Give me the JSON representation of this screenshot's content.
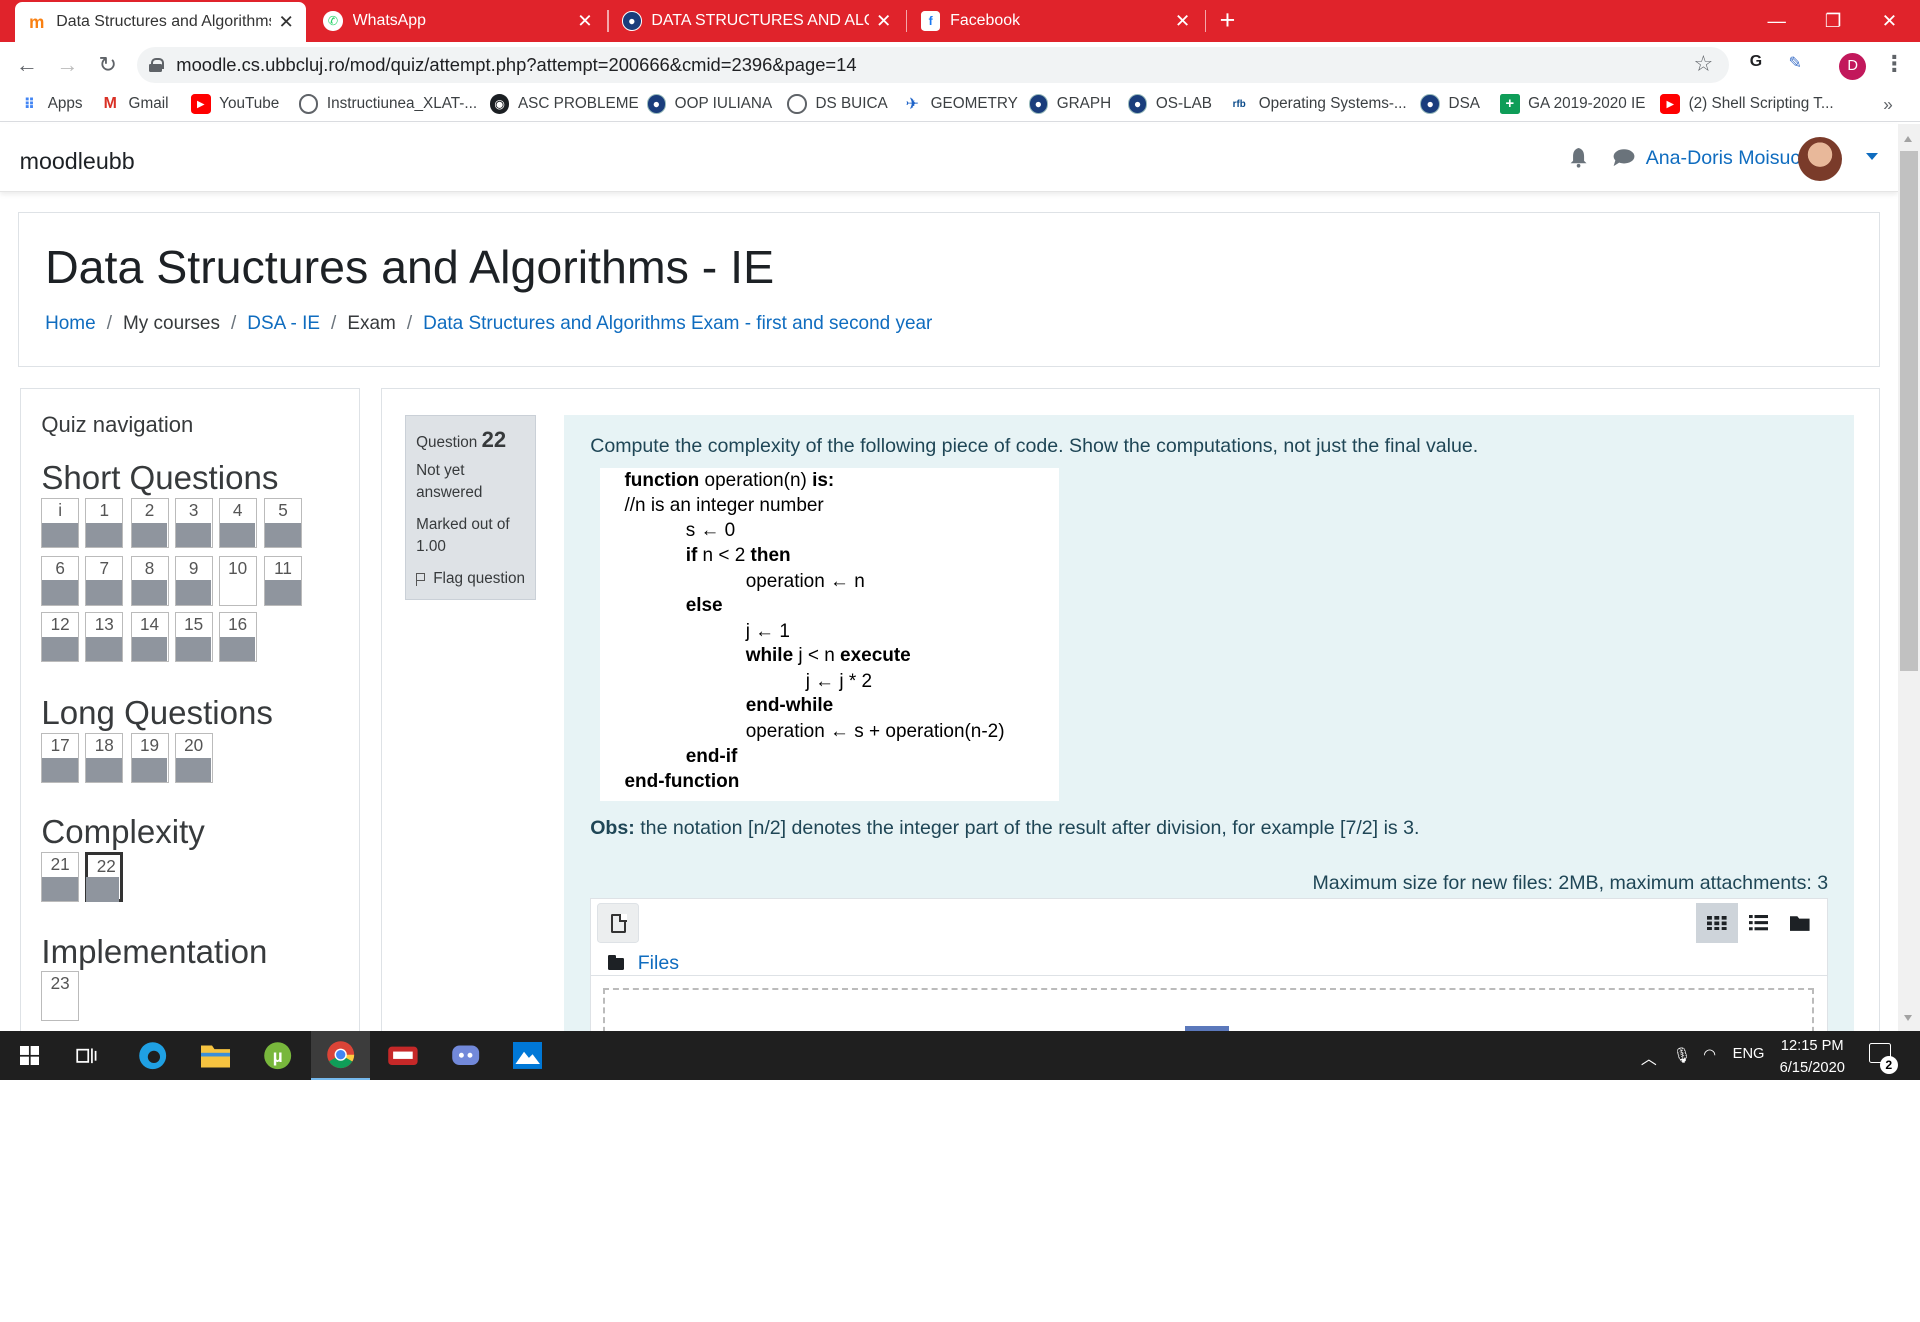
{
  "browser": {
    "tabs": [
      {
        "title": "Data Structures and Algorithms E",
        "favicon": "moodle-icon"
      },
      {
        "title": "WhatsApp",
        "favicon": "whatsapp-icon"
      },
      {
        "title": "DATA STRUCTURES AND ALGORI",
        "favicon": "globe-icon"
      },
      {
        "title": "Facebook",
        "favicon": "facebook-icon"
      }
    ],
    "url": "moodle.cs.ubbcluj.ro/mod/quiz/attempt.php?attempt=200666&cmid=2396&page=14",
    "profile_initial": "D",
    "bookmarks": [
      {
        "label": "Apps"
      },
      {
        "label": "Gmail"
      },
      {
        "label": "YouTube"
      },
      {
        "label": "Instructiunea_XLAT-..."
      },
      {
        "label": "ASC PROBLEME"
      },
      {
        "label": "OOP IULIANA"
      },
      {
        "label": "DS BUICA"
      },
      {
        "label": "GEOMETRY"
      },
      {
        "label": "GRAPH"
      },
      {
        "label": "OS-LAB"
      },
      {
        "label": "Operating Systems-..."
      },
      {
        "label": "DSA"
      },
      {
        "label": "GA 2019-2020 IE"
      },
      {
        "label": "(2) Shell Scripting T..."
      }
    ],
    "bookmarks_more": "»"
  },
  "header": {
    "brand": "moodleubb",
    "user_name": "Ana-Doris Moisuc"
  },
  "page": {
    "title": "Data Structures and Algorithms - IE",
    "breadcrumbs": [
      "Home",
      "My courses",
      "DSA - IE",
      "Exam",
      "Data Structures and Algorithms Exam - first and second year"
    ]
  },
  "quiz_nav": {
    "title": "Quiz navigation",
    "sections": [
      {
        "name": "Short Questions",
        "buttons": [
          "i",
          "1",
          "2",
          "3",
          "4",
          "5",
          "6",
          "7",
          "8",
          "9",
          "10",
          "11",
          "12",
          "13",
          "14",
          "15",
          "16"
        ]
      },
      {
        "name": "Long Questions",
        "buttons": [
          "17",
          "18",
          "19",
          "20"
        ]
      },
      {
        "name": "Complexity",
        "buttons": [
          "21",
          "22"
        ]
      },
      {
        "name": "Implementation",
        "buttons": [
          "23"
        ]
      }
    ],
    "current": "22",
    "unanswered": [
      "10",
      "23"
    ]
  },
  "question": {
    "label": "Question",
    "number": "22",
    "state": "Not yet answered",
    "grade": "Marked out of 1.00",
    "flag": "Flag question",
    "text": "Compute the complexity of the following piece of code. Show the computations, not just the final value.",
    "code": {
      "l1_kw": "function",
      "l1_mid": " operation(n) ",
      "l1_kw2": "is:",
      "l2": "//n is an integer number",
      "l3": "s ← 0",
      "l4_kw": "if",
      "l4_mid": " n < 2 ",
      "l4_kw2": "then",
      "l5": "operation ← n",
      "l6_kw": "else",
      "l7": "j ← 1",
      "l8_kw": "while",
      "l8_mid": " j < n ",
      "l8_kw2": "execute",
      "l9": "j ← j * 2",
      "l10_kw": "end-while",
      "l11": "operation ← s + operation(n-2)",
      "l12_kw": "end-if",
      "l13_kw": "end-function"
    },
    "obs_label": "Obs:",
    "obs_text": " the notation [n/2] denotes the integer part of the result after division, for example [7/2] is 3.",
    "max_files": "Maximum size for new files: 2MB, maximum attachments: 3",
    "files_label": "Files"
  },
  "taskbar": {
    "lang": "ENG",
    "time": "12:15 PM",
    "date": "6/15/2020",
    "notifications": "2"
  }
}
